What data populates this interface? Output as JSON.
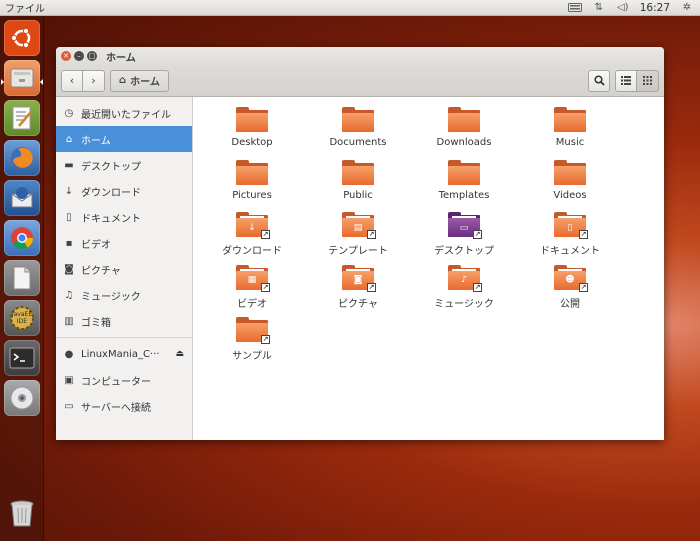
{
  "top_panel": {
    "app_title": "ファイル",
    "clock": "16:27",
    "indicators": [
      "keyboard-icon",
      "network-icon",
      "volume-icon",
      "settings-icon"
    ]
  },
  "launcher": {
    "items": [
      "ubuntu-logo-icon",
      "files-icon",
      "text-editor-icon",
      "firefox-icon",
      "thunderbird-icon",
      "chrome-icon",
      "libreoffice-icon",
      "java-ee-ide-icon",
      "terminal-icon",
      "dvd-icon",
      "trash-icon"
    ],
    "java_label": "JavaEE IDE"
  },
  "window": {
    "title": "ホーム",
    "path_button": "ホーム"
  },
  "sidebar": {
    "items": [
      {
        "label": "最近開いたファイル",
        "icon": "clock-icon"
      },
      {
        "label": "ホーム",
        "icon": "home-icon"
      },
      {
        "label": "デスクトップ",
        "icon": "desktop-folder-icon"
      },
      {
        "label": "ダウンロード",
        "icon": "download-icon"
      },
      {
        "label": "ドキュメント",
        "icon": "document-icon"
      },
      {
        "label": "ビデオ",
        "icon": "video-icon"
      },
      {
        "label": "ピクチャ",
        "icon": "camera-icon"
      },
      {
        "label": "ミュージック",
        "icon": "music-icon"
      },
      {
        "label": "ゴミ箱",
        "icon": "trash-icon"
      },
      {
        "label": "LinuxMania_C···",
        "icon": "drive-icon"
      },
      {
        "label": "コンピューター",
        "icon": "computer-icon"
      },
      {
        "label": "サーバーへ接続",
        "icon": "server-icon"
      }
    ]
  },
  "files": [
    {
      "name": "Desktop",
      "emblem": ""
    },
    {
      "name": "Documents",
      "emblem": ""
    },
    {
      "name": "Downloads",
      "emblem": ""
    },
    {
      "name": "Music",
      "emblem": ""
    },
    {
      "name": "Pictures",
      "emblem": ""
    },
    {
      "name": "Public",
      "emblem": ""
    },
    {
      "name": "Templates",
      "emblem": ""
    },
    {
      "name": "Videos",
      "emblem": ""
    },
    {
      "name": "ダウンロード",
      "emblem": "download-icon"
    },
    {
      "name": "テンプレート",
      "emblem": "template-icon"
    },
    {
      "name": "デスクトップ",
      "emblem": "desktop-icon"
    },
    {
      "name": "ドキュメント",
      "emblem": "document-icon"
    },
    {
      "name": "ビデオ",
      "emblem": "film-icon"
    },
    {
      "name": "ピクチャ",
      "emblem": "camera-icon"
    },
    {
      "name": "ミュージック",
      "emblem": "music-note-icon"
    },
    {
      "name": "公開",
      "emblem": "person-icon"
    },
    {
      "name": "サンプル",
      "emblem": ""
    }
  ]
}
